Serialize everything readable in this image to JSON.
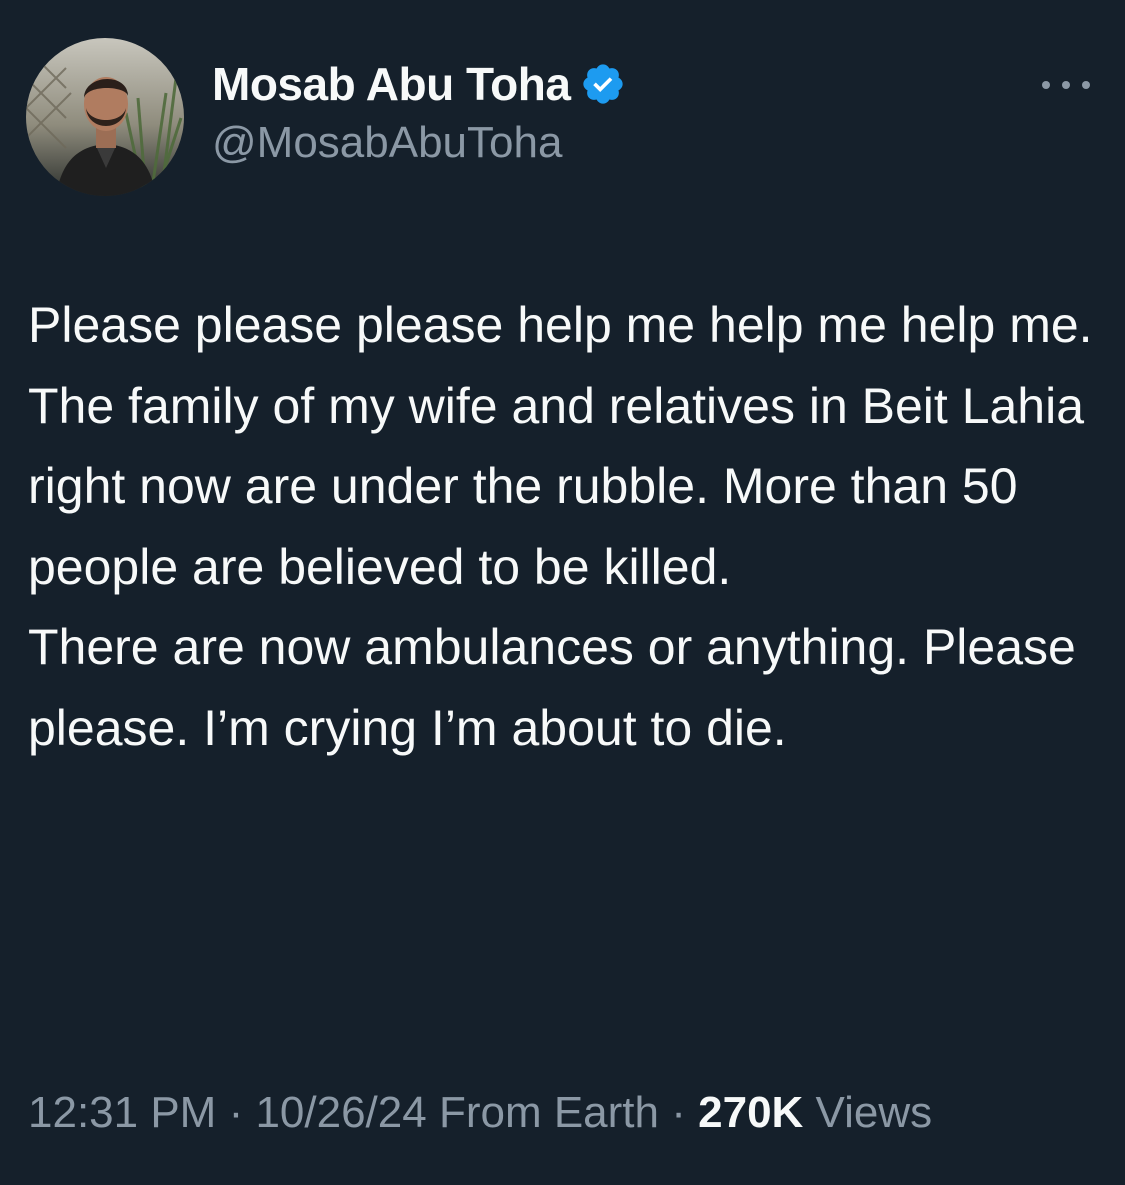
{
  "author": {
    "display_name": "Mosab Abu Toha",
    "handle": "@MosabAbuToha",
    "verified": true,
    "avatar_icon": "profile-photo-icon",
    "verified_icon": "verified-badge-icon",
    "verified_color": "#1d9bf0"
  },
  "menu": {
    "icon": "more-options-icon"
  },
  "tweet": {
    "text": "Please please please help me help me help me.\nThe family of my wife and relatives in Beit Lahia right now are under the rubble. More than 50 people are believed to be killed.\nThere are now ambulances or anything. Please please. I’m crying I’m about to die."
  },
  "meta": {
    "time": "12:31 PM",
    "separator": " · ",
    "date": "10/26/24",
    "source": " From Earth",
    "views_count": "270K",
    "views_label": " Views"
  },
  "colors": {
    "background": "#15202b",
    "text_primary": "#f7f9f9",
    "text_secondary": "#8b98a5",
    "accent": "#1d9bf0"
  }
}
